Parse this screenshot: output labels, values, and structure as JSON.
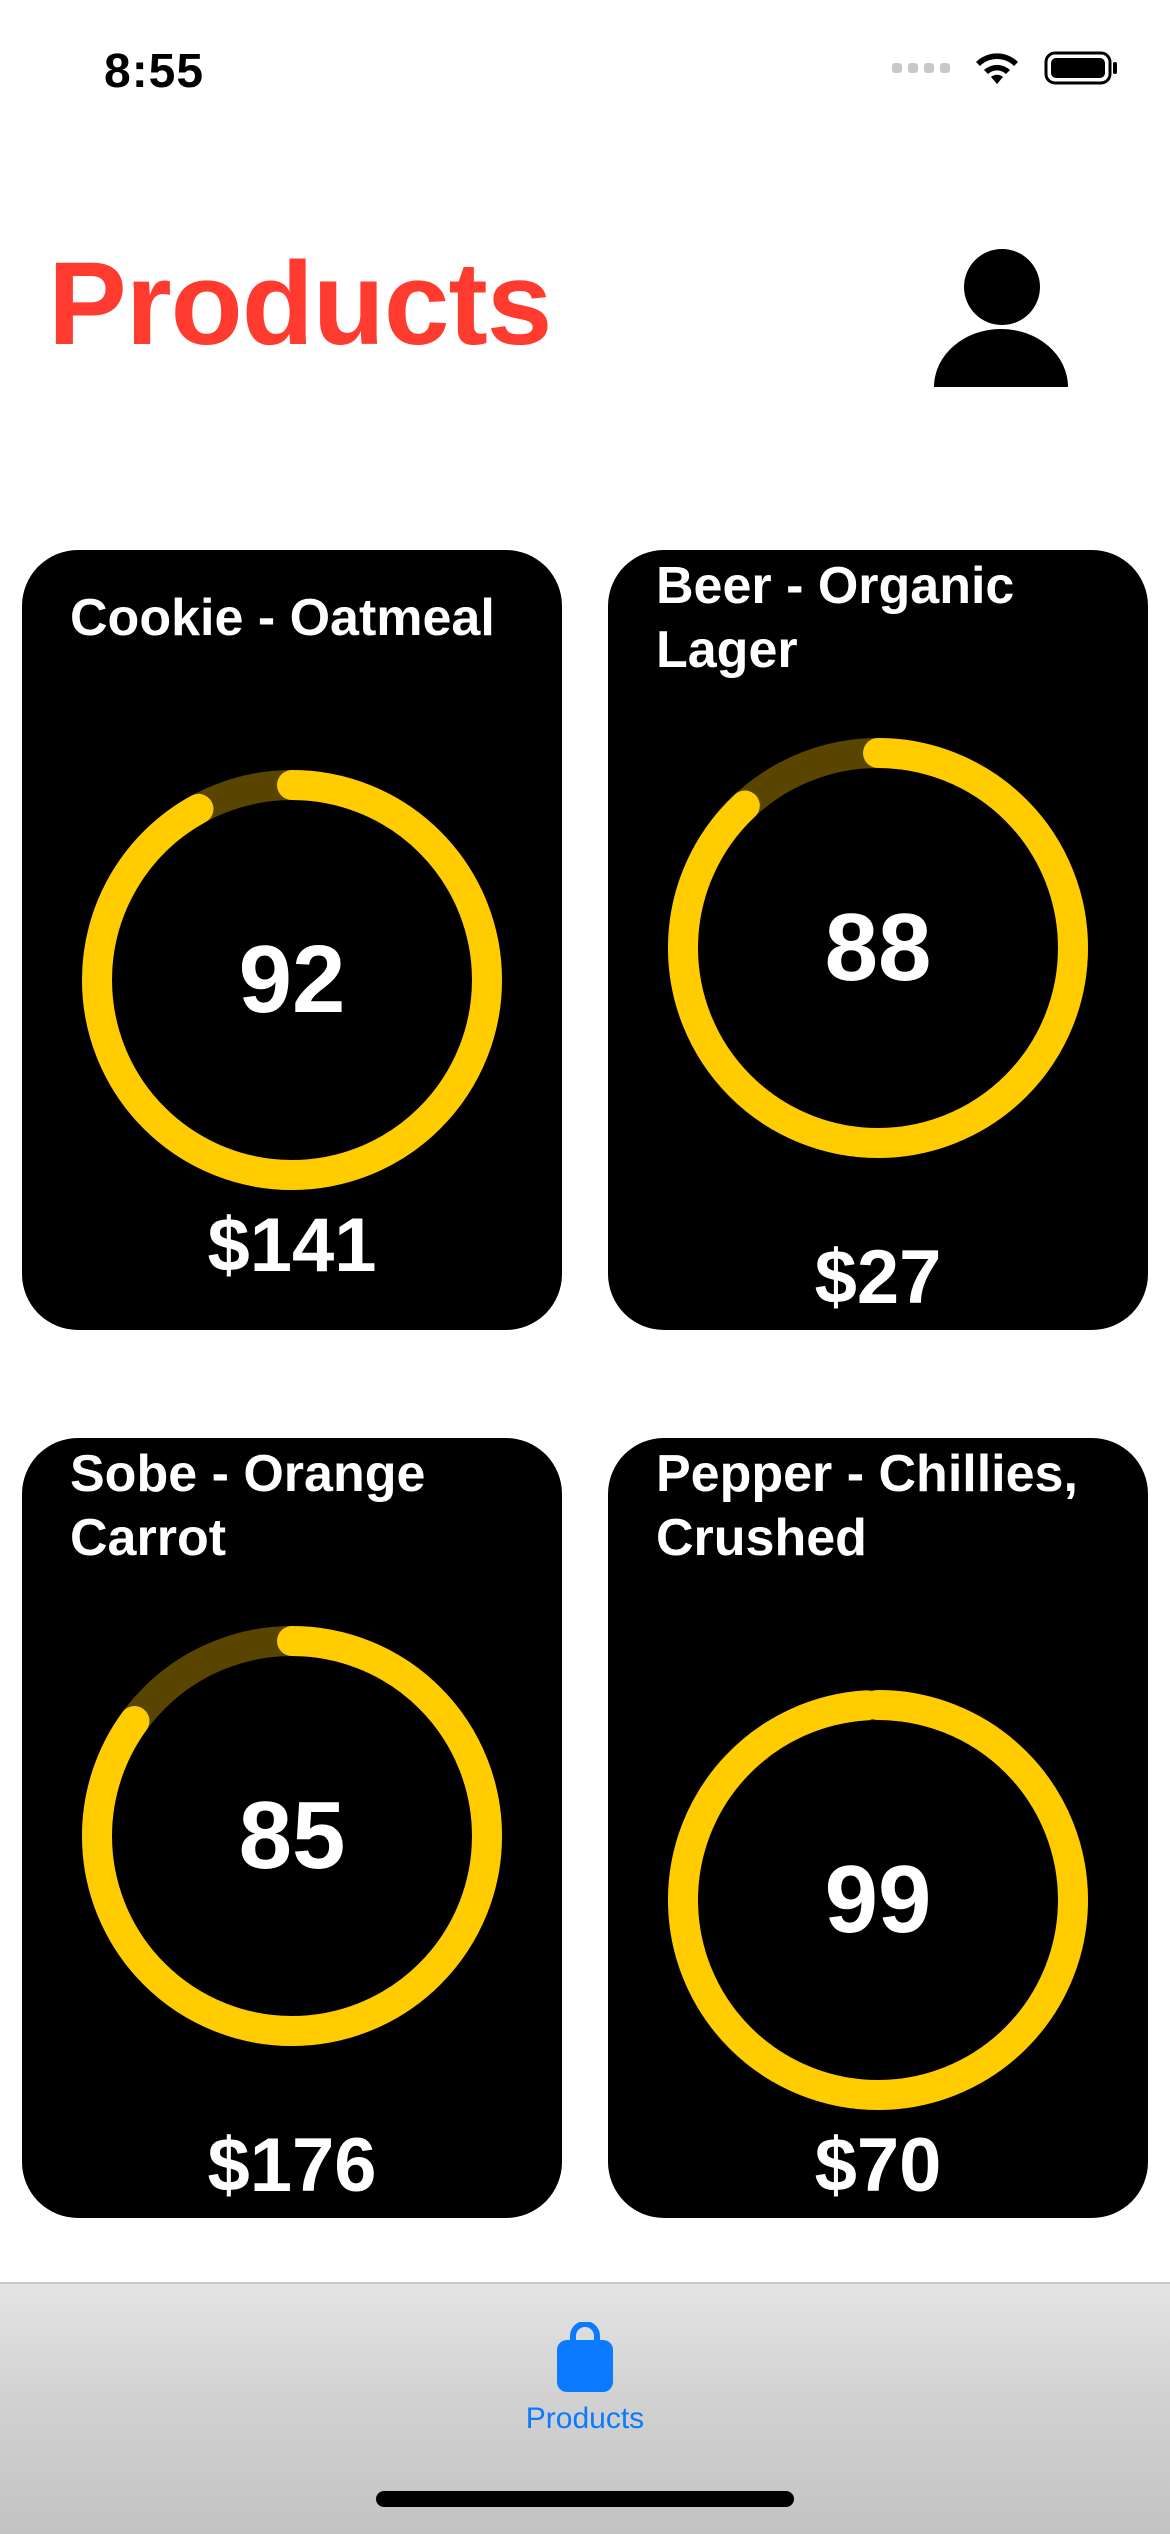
{
  "status_bar": {
    "time": "8:55"
  },
  "header": {
    "title": "Products"
  },
  "products": [
    {
      "name": "Cookie - Oatmeal",
      "score": "92",
      "score_fraction": 0.92,
      "price": "$141"
    },
    {
      "name": "Beer - Organic Lager",
      "score": "88",
      "score_fraction": 0.88,
      "price": "$27"
    },
    {
      "name": "Sobe - Orange Carrot",
      "score": "85",
      "score_fraction": 0.85,
      "price": "$176"
    },
    {
      "name": "Pepper - Chillies, Crushed",
      "score": "99",
      "score_fraction": 0.99,
      "price": "$70"
    }
  ],
  "colors": {
    "title": "#ff3b30",
    "ring": "#ffcc00",
    "ring_track": "#594400",
    "tab_active": "#0a7aff"
  },
  "tab_bar": {
    "tabs": [
      {
        "label": "Products",
        "icon": "shopping-bag-icon"
      }
    ]
  }
}
